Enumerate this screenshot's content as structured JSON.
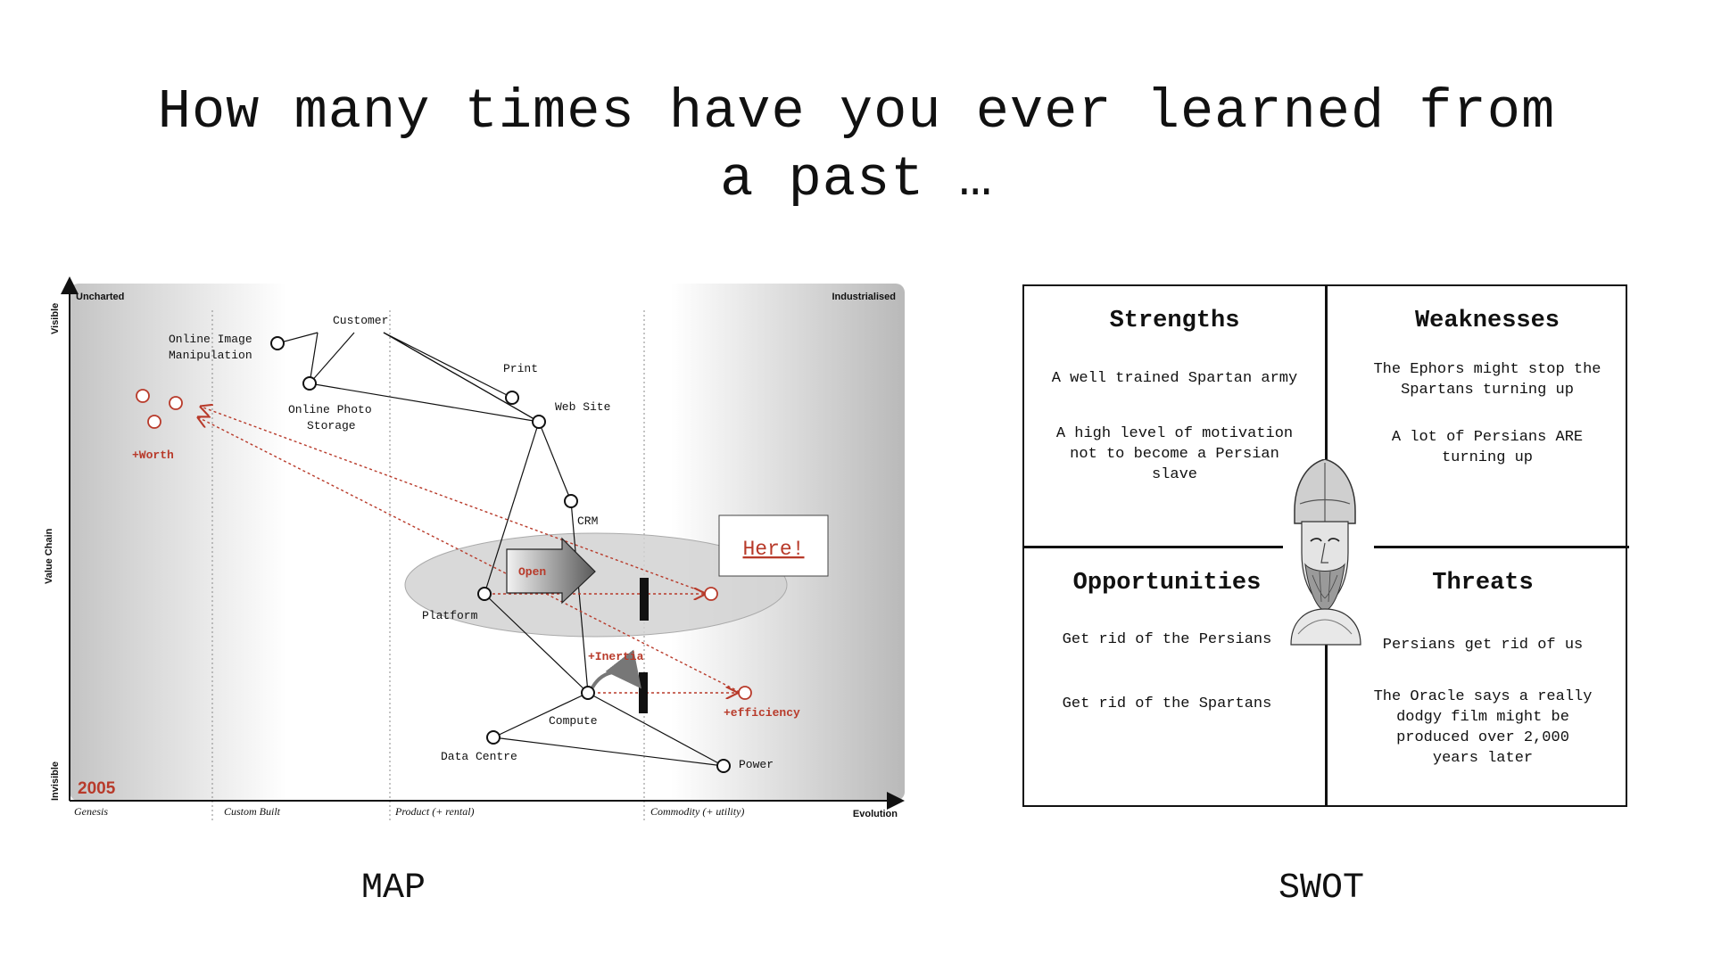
{
  "slide": {
    "title_line1": "How many times have you ever learned from",
    "title_line2": "a past …",
    "caption_map": "MAP",
    "caption_swot": "SWOT"
  },
  "map": {
    "corner_left": "Uncharted",
    "corner_right": "Industrialised",
    "y_axis": {
      "top": "Visible",
      "middle": "Value Chain",
      "bottom": "Invisible"
    },
    "x_axis": {
      "stages": [
        "Genesis",
        "Custom Built",
        "Product (+ rental)",
        "Commodity (+ utility)"
      ],
      "label": "Evolution"
    },
    "year": "2005",
    "nodes": {
      "customer": "Customer",
      "online_image": [
        "Online Image",
        "Manipulation"
      ],
      "online_photo": [
        "Online Photo",
        "Storage"
      ],
      "print": "Print",
      "web_site": "Web Site",
      "crm": "CRM",
      "platform": "Platform",
      "compute": "Compute",
      "data_centre": "Data Centre",
      "power": "Power"
    },
    "annotations": {
      "worth": "+Worth",
      "open": "Open",
      "inertia": "+Inertia",
      "efficiency": "+efficiency",
      "here": "Here!"
    },
    "accent_color": "#b83a2a"
  },
  "swot": {
    "strengths": {
      "title": "Strengths",
      "items": [
        "A well trained Spartan army",
        "A high level of motivation",
        "not to become a Persian",
        "slave"
      ]
    },
    "weaknesses": {
      "title": "Weaknesses",
      "items": [
        "The Ephors might stop the",
        "Spartans turning up",
        "A lot of Persians ARE",
        "turning up"
      ]
    },
    "opportunities": {
      "title": "Opportunities",
      "items": [
        "Get rid of the Persians",
        "Get rid of the Spartans"
      ]
    },
    "threats": {
      "title": "Threats",
      "items": [
        "Persians get rid of us",
        "The Oracle says a really",
        "dodgy film might be",
        "produced over 2,000",
        "years later"
      ]
    }
  }
}
